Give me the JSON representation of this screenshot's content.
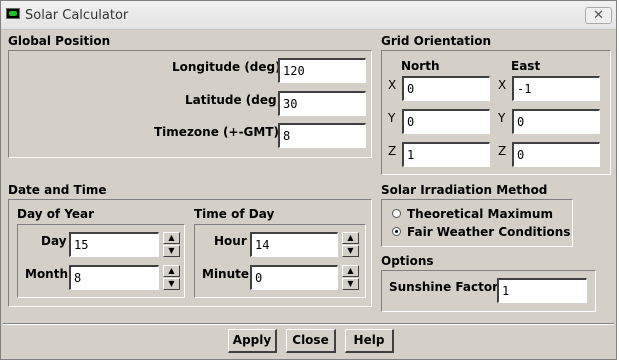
{
  "window": {
    "title": "Solar Calculator",
    "close_glyph": "✕"
  },
  "global_position": {
    "heading": "Global Position",
    "longitude": {
      "label": "Longitude (deg)",
      "value": "120"
    },
    "latitude": {
      "label": "Latitude (deg)",
      "value": "30"
    },
    "timezone": {
      "label": "Timezone (+-GMT)",
      "value": "8"
    }
  },
  "grid_orientation": {
    "heading": "Grid Orientation",
    "north": {
      "label": "North",
      "x": {
        "axis": "X",
        "value": "0"
      },
      "y": {
        "axis": "Y",
        "value": "0"
      },
      "z": {
        "axis": "Z",
        "value": "1"
      }
    },
    "east": {
      "label": "East",
      "x": {
        "axis": "X",
        "value": "-1"
      },
      "y": {
        "axis": "Y",
        "value": "0"
      },
      "z": {
        "axis": "Z",
        "value": "0"
      }
    }
  },
  "date_and_time": {
    "heading": "Date and Time",
    "day_of_year": {
      "heading": "Day of Year",
      "day": {
        "label": "Day",
        "value": "15"
      },
      "month": {
        "label": "Month",
        "value": "8"
      }
    },
    "time_of_day": {
      "heading": "Time of Day",
      "hour": {
        "label": "Hour",
        "value": "14"
      },
      "minute": {
        "label": "Minute",
        "value": "0"
      }
    }
  },
  "solar_irradiation": {
    "heading": "Solar Irradiation Method",
    "options": [
      {
        "label": "Theoretical Maximum",
        "selected": false
      },
      {
        "label": "Fair Weather Conditions",
        "selected": true
      }
    ]
  },
  "options": {
    "heading": "Options",
    "sunshine_factor": {
      "label": "Sunshine Factor",
      "value": "1"
    }
  },
  "buttons": {
    "apply": "Apply",
    "close": "Close",
    "help": "Help"
  },
  "icons": {
    "spin_up": "▲",
    "spin_down": "▼"
  }
}
